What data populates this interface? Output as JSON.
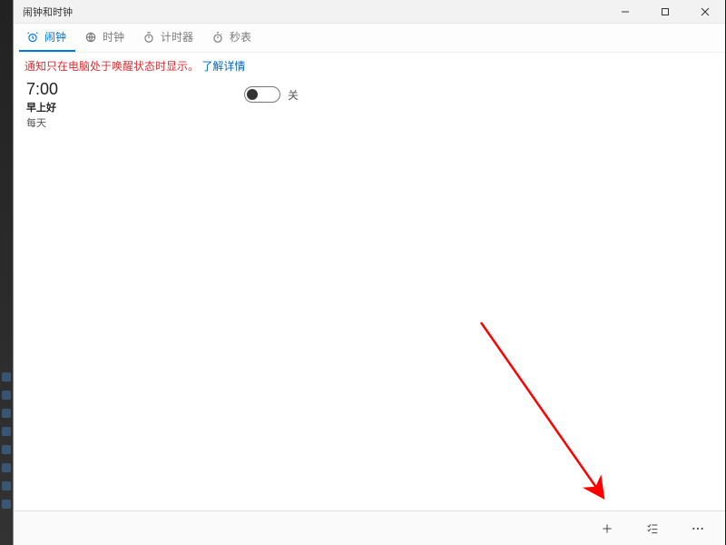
{
  "window": {
    "title": "闹钟和时钟"
  },
  "tabs": {
    "alarm": "闹钟",
    "clock": "时钟",
    "timer": "计时器",
    "stopwatch": "秒表"
  },
  "notice": {
    "text": "通知只在电脑处于唤醒状态时显示。",
    "link": "了解详情"
  },
  "alarm0": {
    "time": "7:00",
    "name": "早上好",
    "repeat": "每天",
    "state_label": "关"
  },
  "cmdbar": {
    "add_tooltip": "添加",
    "select_tooltip": "选择",
    "more_tooltip": "更多"
  }
}
